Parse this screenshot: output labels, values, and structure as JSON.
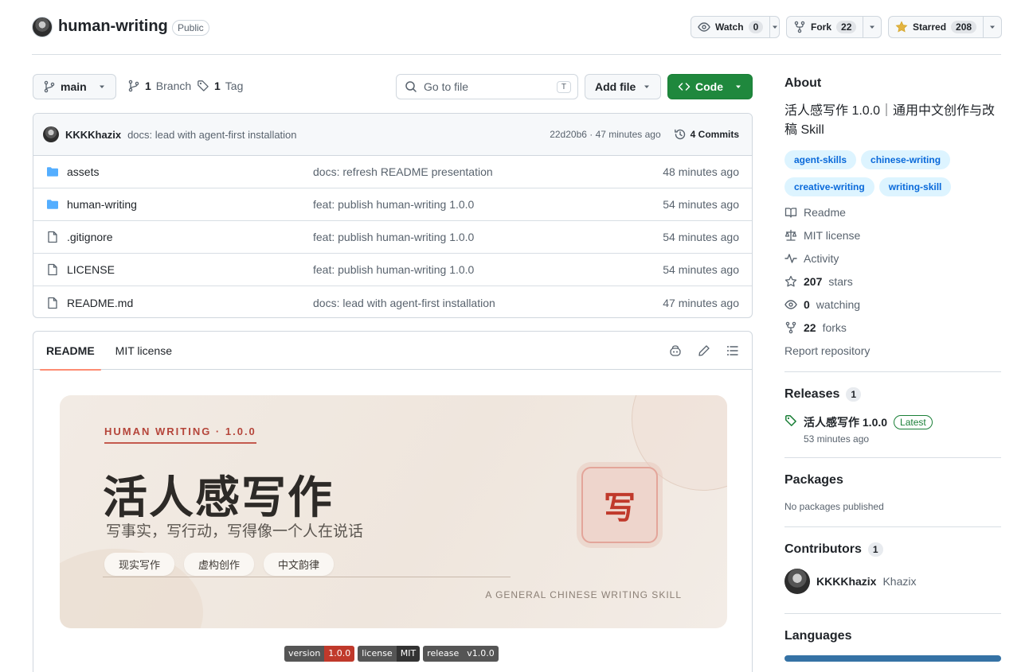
{
  "repo": {
    "name": "human-writing",
    "visibility": "Public"
  },
  "header_actions": {
    "watch": {
      "label": "Watch",
      "count": "0"
    },
    "fork": {
      "label": "Fork",
      "count": "22"
    },
    "star": {
      "label": "Starred",
      "count": "208"
    }
  },
  "toolbar": {
    "branch": "main",
    "branches_count": "1",
    "branches_label": "Branch",
    "tags_count": "1",
    "tags_label": "Tag",
    "goto_placeholder": "Go to file",
    "goto_kbd": "T",
    "add_file": "Add file",
    "code": "Code"
  },
  "latest_commit": {
    "author": "KKKKhazix",
    "message": "docs: lead with agent-first installation",
    "meta": "22d20b6 · 47 minutes ago",
    "commits_label": "4 Commits"
  },
  "files": [
    {
      "name": "assets",
      "type": "folder",
      "message": "docs: refresh README presentation",
      "time": "48 minutes ago"
    },
    {
      "name": "human-writing",
      "type": "folder",
      "message": "feat: publish human-writing 1.0.0",
      "time": "54 minutes ago"
    },
    {
      "name": ".gitignore",
      "type": "file",
      "message": "feat: publish human-writing 1.0.0",
      "time": "54 minutes ago"
    },
    {
      "name": "LICENSE",
      "type": "file",
      "message": "feat: publish human-writing 1.0.0",
      "time": "54 minutes ago"
    },
    {
      "name": "README.md",
      "type": "file",
      "message": "docs: lead with agent-first installation",
      "time": "47 minutes ago"
    }
  ],
  "readme": {
    "tabs": [
      "README",
      "MIT license"
    ],
    "banner": {
      "kicker": "HUMAN WRITING · 1.0.0",
      "title": "活人感写作",
      "subtitle": "写事实，写行动，写得像一个人在说话",
      "chips": [
        "现实写作",
        "虚构创作",
        "中文韵律"
      ],
      "footer": "A GENERAL CHINESE WRITING SKILL",
      "seal": "写"
    },
    "shields": [
      {
        "label": "version",
        "value": "1.0.0",
        "color": "#c0392b"
      },
      {
        "label": "license",
        "value": "MIT",
        "color": "#333333"
      },
      {
        "label": "release",
        "value": "v1.0.0",
        "color": "#555555"
      }
    ]
  },
  "sidebar": {
    "about_title": "About",
    "description": "活人感写作 1.0.0｜通用中文创作与改稿 Skill",
    "topics": [
      "agent-skills",
      "chinese-writing",
      "creative-writing",
      "writing-skill"
    ],
    "links": {
      "readme": "Readme",
      "license": "MIT license",
      "activity": "Activity",
      "stars_count": "207",
      "stars_label": "stars",
      "watching_count": "0",
      "watching_label": "watching",
      "forks_count": "22",
      "forks_label": "forks",
      "report": "Report repository"
    },
    "releases": {
      "title": "Releases",
      "count": "1",
      "name": "活人感写作 1.0.0",
      "badge": "Latest",
      "date": "53 minutes ago"
    },
    "packages": {
      "title": "Packages",
      "empty": "No packages published"
    },
    "contributors": {
      "title": "Contributors",
      "count": "1",
      "login": "KKKKhazix",
      "name": "Khazix"
    },
    "languages": {
      "title": "Languages",
      "bar_color": "#3572a5"
    }
  }
}
